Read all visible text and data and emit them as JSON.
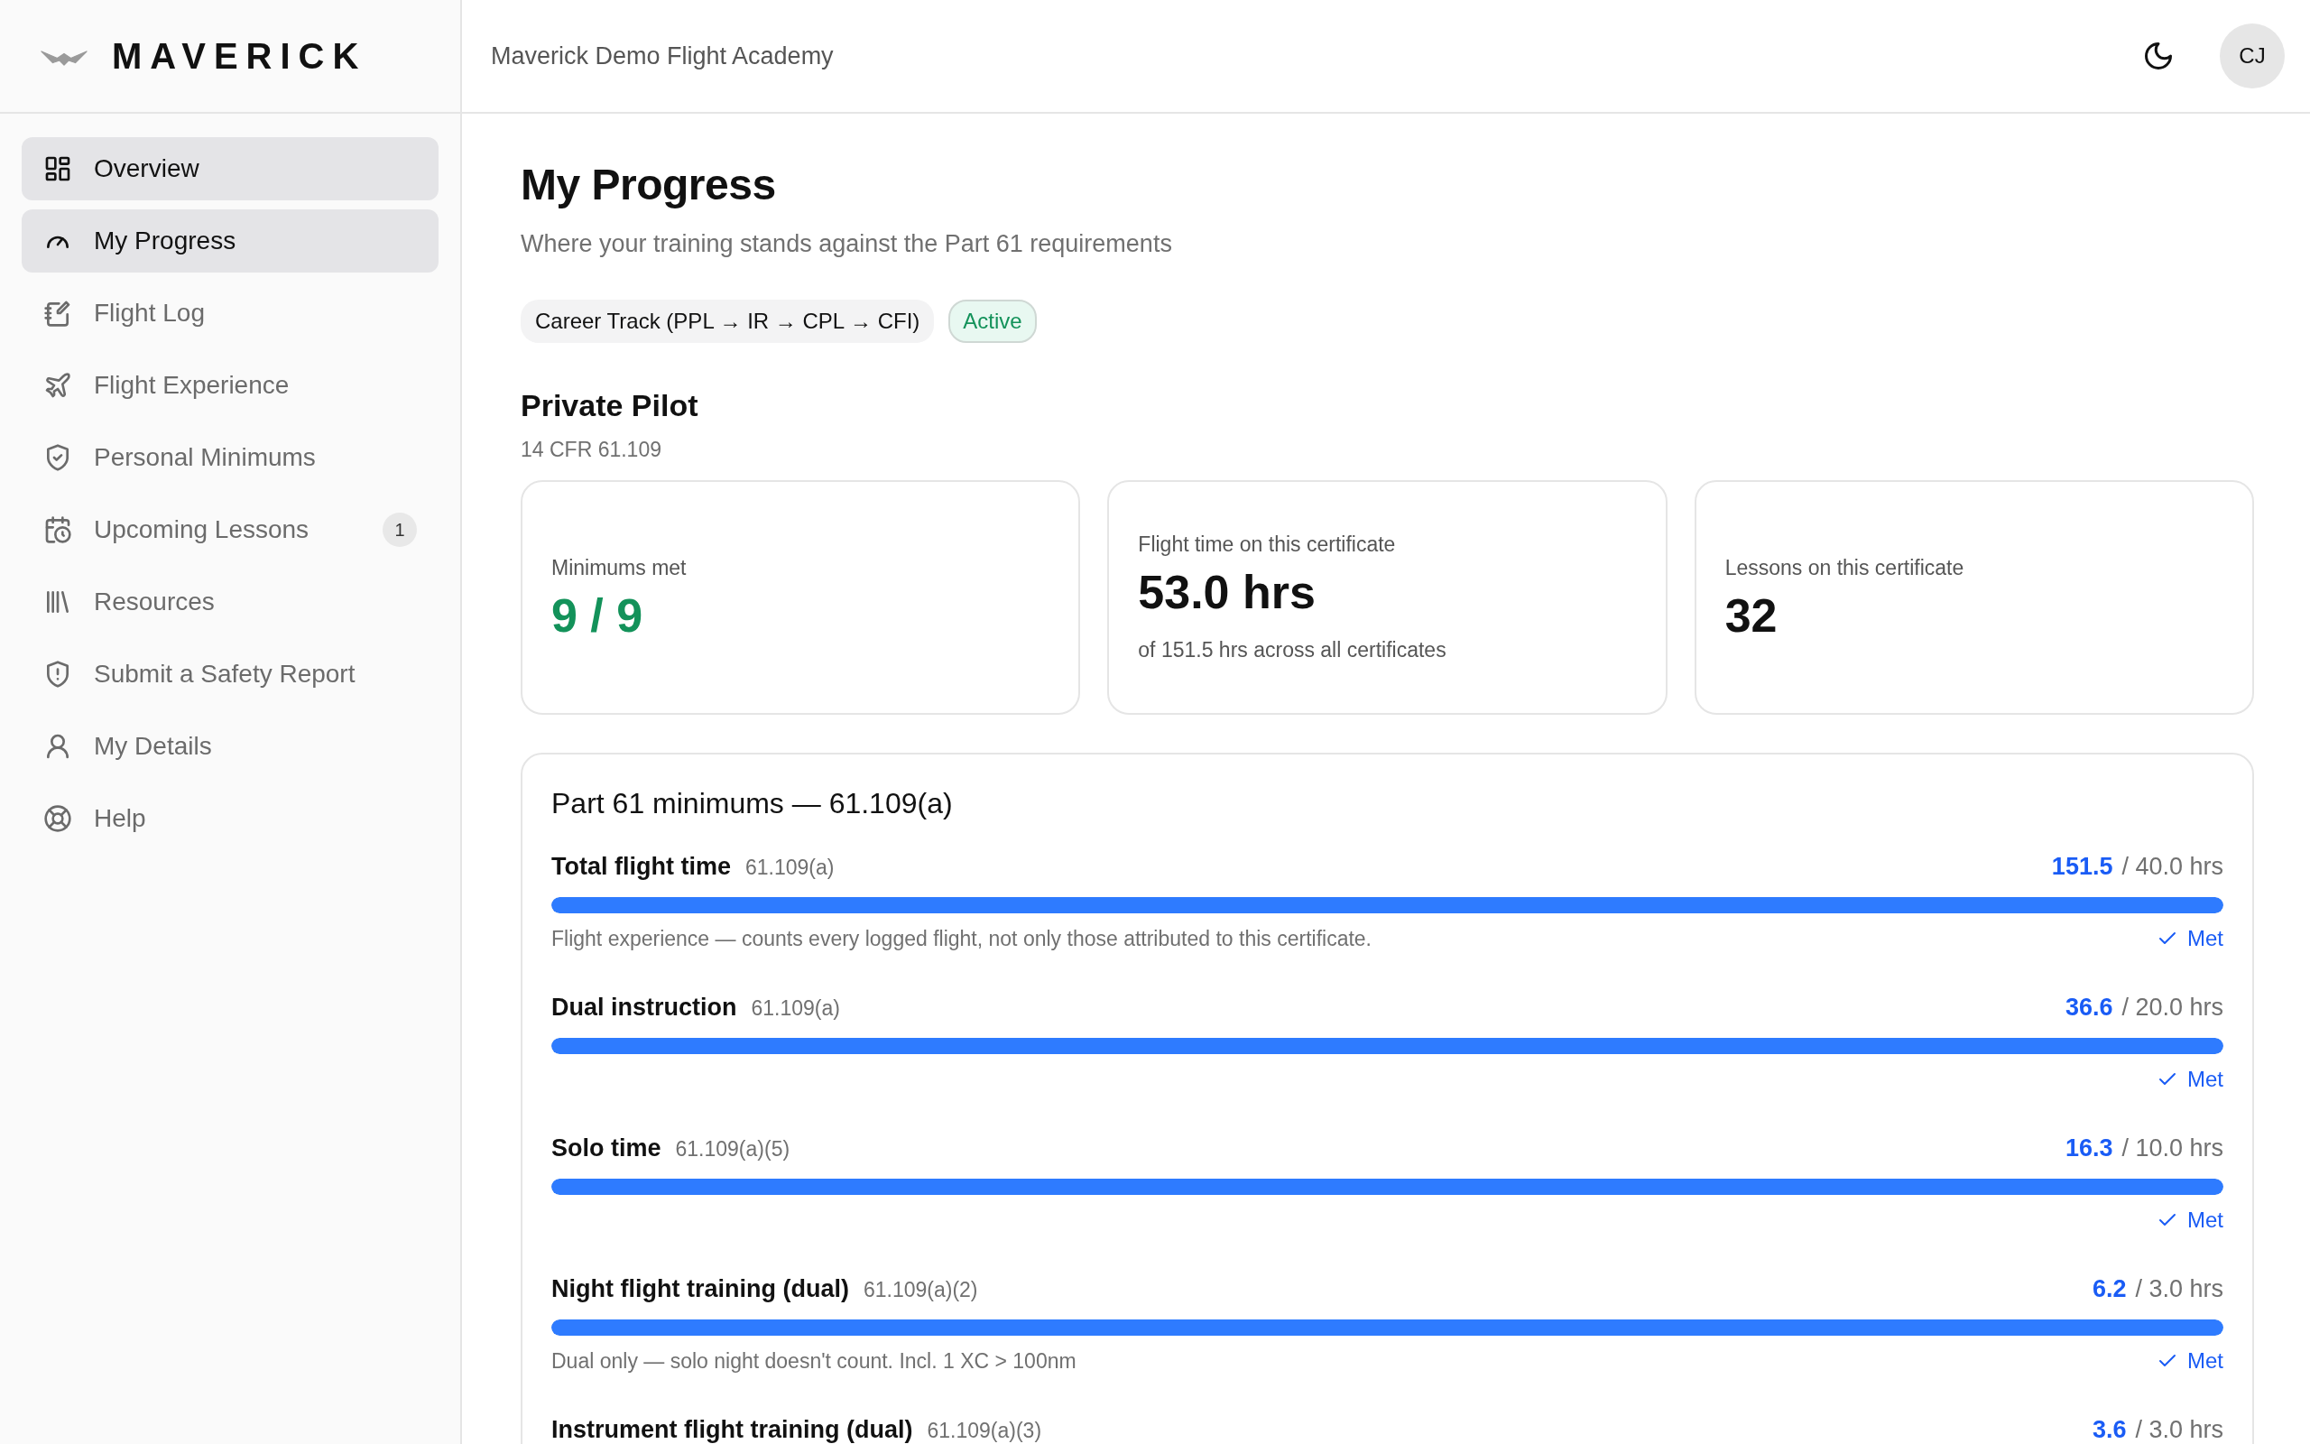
{
  "brand": {
    "name": "MAVERICK"
  },
  "sidebar": {
    "items": [
      {
        "label": "Overview",
        "selected": true
      },
      {
        "label": "My Progress",
        "selected": true
      },
      {
        "label": "Flight Log",
        "selected": false
      },
      {
        "label": "Flight Experience",
        "selected": false
      },
      {
        "label": "Personal Minimums",
        "selected": false
      },
      {
        "label": "Upcoming Lessons",
        "selected": false,
        "badge": "1"
      },
      {
        "label": "Resources",
        "selected": false
      },
      {
        "label": "Submit a Safety Report",
        "selected": false
      },
      {
        "label": "My Details",
        "selected": false
      },
      {
        "label": "Help",
        "selected": false
      }
    ]
  },
  "header": {
    "academy": "Maverick Demo Flight Academy",
    "avatar": "CJ"
  },
  "page": {
    "title": "My Progress",
    "subtitle": "Where your training stands against the Part 61 requirements"
  },
  "track": {
    "label": "Career Track (PPL → IR → CPL → CFI)",
    "status": "Active"
  },
  "certificate": {
    "title": "Private Pilot",
    "reference": "14 CFR 61.109"
  },
  "stat_cards": [
    {
      "label": "Minimums met",
      "value": "9 / 9",
      "color": "#13925a"
    },
    {
      "label": "Flight time on this certificate",
      "value": "53.0 hrs",
      "note": "of 151.5 hrs across all certificates",
      "color": "#111111"
    },
    {
      "label": "Lessons on this certificate",
      "value": "32",
      "color": "#111111"
    }
  ],
  "minimums": {
    "title": "Part 61 minimums — 61.109(a)",
    "rows": [
      {
        "label": "Total flight time",
        "code": "61.109(a)",
        "value": "151.5",
        "target": "/ 40.0 hrs",
        "level": 1,
        "note": "Flight experience — counts every logged flight, not only those attributed to this certificate.",
        "met": true,
        "status": "Met"
      },
      {
        "label": "Dual instruction",
        "code": "61.109(a)",
        "value": "36.6",
        "target": "/ 20.0 hrs",
        "level": 1,
        "met": true,
        "status": "Met"
      },
      {
        "label": "Solo time",
        "code": "61.109(a)(5)",
        "value": "16.3",
        "target": "/ 10.0 hrs",
        "level": 1,
        "met": true,
        "status": "Met"
      },
      {
        "label": "Night flight training (dual)",
        "code": "61.109(a)(2)",
        "value": "6.2",
        "target": "/ 3.0 hrs",
        "level": 1,
        "note": "Dual only — solo night doesn't count. Incl. 1 XC > 100nm",
        "met": true,
        "status": "Met"
      },
      {
        "label": "Instrument flight training (dual)",
        "code": "61.109(a)(3)",
        "value": "3.6",
        "target": "/ 3.0 hrs"
      }
    ]
  }
}
